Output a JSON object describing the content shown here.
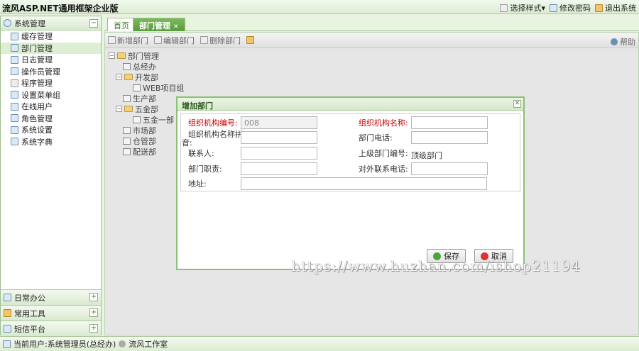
{
  "app": {
    "title": "流风ASP.NET通用框架企业版"
  },
  "header_links": [
    {
      "label": "选择样式▾",
      "icon": "window-icon"
    },
    {
      "label": "修改密码",
      "icon": "key-icon"
    },
    {
      "label": "退出系统",
      "icon": "exit-icon"
    }
  ],
  "sidebar": {
    "section_title": "系统管理",
    "items": [
      {
        "label": "缓存管理"
      },
      {
        "label": "部门管理"
      },
      {
        "label": "日志管理"
      },
      {
        "label": "操作员管理"
      },
      {
        "label": "程序管理"
      },
      {
        "label": "设置菜单组"
      },
      {
        "label": "在线用户"
      },
      {
        "label": "角色管理"
      },
      {
        "label": "系统设置"
      },
      {
        "label": "系统字典"
      }
    ],
    "bottom_sections": [
      {
        "label": "日常办公"
      },
      {
        "label": "常用工具"
      },
      {
        "label": "短信平台"
      }
    ]
  },
  "tabs": [
    {
      "label": "首页"
    },
    {
      "label": "部门管理"
    }
  ],
  "toolbar": {
    "add": "新增部门",
    "edit": "编辑部门",
    "delete": "删除部门",
    "help": "帮助"
  },
  "tree": {
    "root": "部门管理",
    "nodes": [
      "总经办",
      "开发部",
      "WEB项目组",
      "生产部",
      "五金部",
      "五金一部",
      "市场部",
      "仓管部",
      "配送部"
    ]
  },
  "dialog": {
    "title": "增加部门",
    "fields": {
      "org_code_label": "组织机构编号:",
      "org_code_value": "008",
      "org_name_label": "组织机构名称:",
      "org_pinyin_label_1": "组织机构名称拼",
      "org_pinyin_label_2": "音:",
      "phone_label": "部门电话:",
      "contact_label": "联系人:",
      "parent_code_label": "上级部门编号:",
      "parent_code_value": "顶级部门",
      "duty_label": "部门职责:",
      "external_phone_label": "对外联系电话:",
      "address_label": "地址:"
    },
    "save": "保存",
    "cancel": "取消"
  },
  "watermark": "https://www.huzhan.com/ishop21194",
  "status": {
    "user": "当前用户:系统管理员(总经办)",
    "studio": "流风工作室"
  }
}
